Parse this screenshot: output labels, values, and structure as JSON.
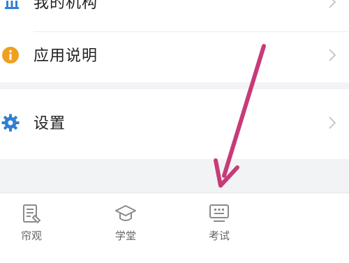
{
  "menu": {
    "institution_label": "我的机构",
    "guide_label": "应用说明",
    "settings_label": "设置"
  },
  "tabbar": {
    "items": [
      {
        "label": "帘观"
      },
      {
        "label": "学堂"
      },
      {
        "label": "考试"
      }
    ]
  },
  "colors": {
    "accent_blue": "#2f7fd6",
    "info_orange": "#f0a020",
    "annotation_arrow": "#c83a78"
  }
}
